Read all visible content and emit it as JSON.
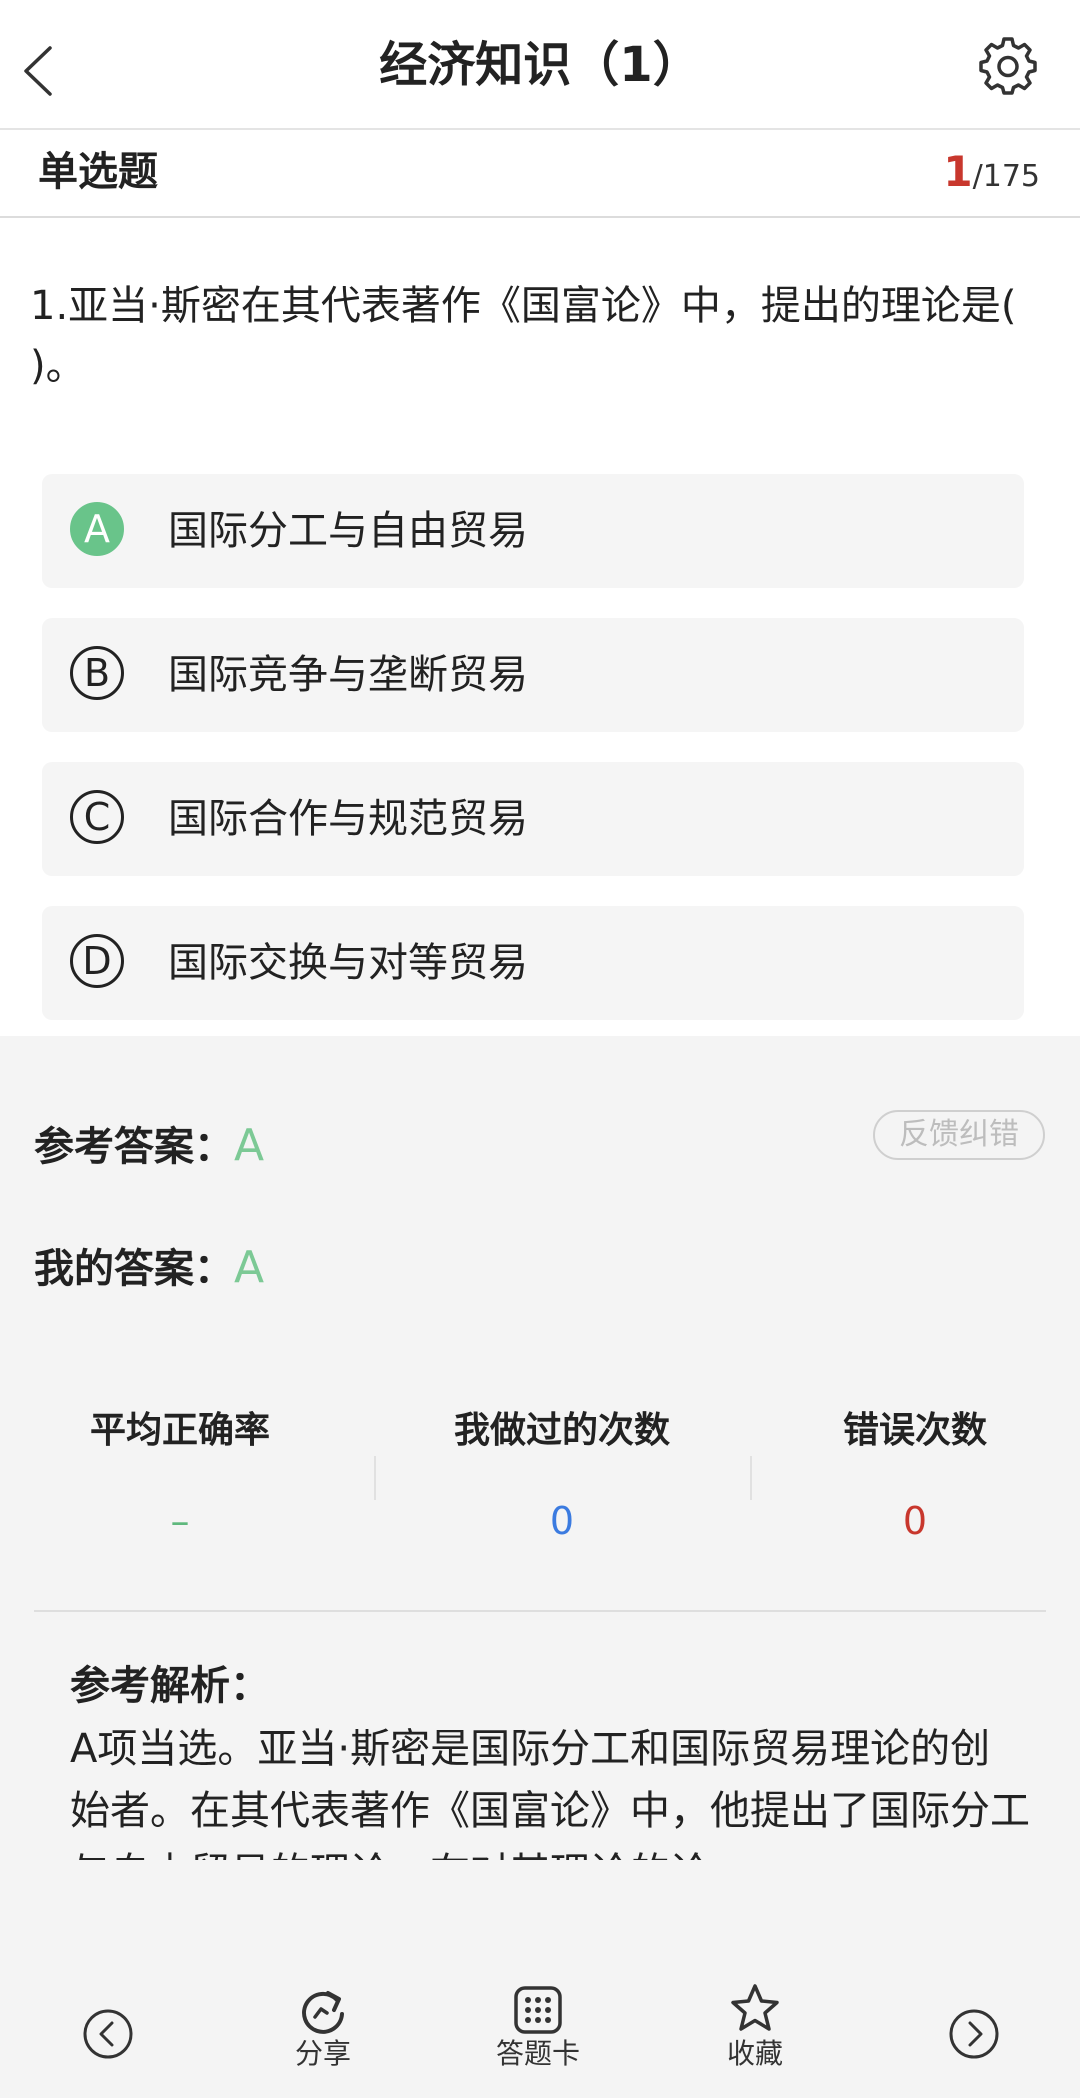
{
  "header": {
    "title": "经济知识（1）",
    "back_icon": "chevron-left-icon",
    "settings_icon": "gear-icon"
  },
  "subheader": {
    "question_type": "单选题",
    "current": "1",
    "total": "/175"
  },
  "question": {
    "text": "1.亚当·斯密在其代表著作《国富论》中，提出的理论是( )。"
  },
  "options": [
    {
      "letter": "A",
      "text": "国际分工与自由贸易",
      "selected": true
    },
    {
      "letter": "B",
      "text": "国际竞争与垄断贸易",
      "selected": false
    },
    {
      "letter": "C",
      "text": "国际合作与规范贸易",
      "selected": false
    },
    {
      "letter": "D",
      "text": "国际交换与对等贸易",
      "selected": false
    }
  ],
  "answer": {
    "reference_label": "参考答案：",
    "reference_value": "A",
    "mine_label": "我的答案：",
    "mine_value": "A",
    "feedback_button": "反馈纠错"
  },
  "stats": [
    {
      "label": "平均正确率",
      "value": "–",
      "color": "#5fb87d"
    },
    {
      "label": "我做过的次数",
      "value": "0",
      "color": "#3b7be0"
    },
    {
      "label": "错误次数",
      "value": "0",
      "color": "#c8372d"
    }
  ],
  "analysis": {
    "title": "参考解析：",
    "text": "A项当选。亚当·斯密是国际分工和国际贸易理论的创始者。在其代表著作《国富论》中，他提出了国际分工与自由贸易的理论，在对其理论的论"
  },
  "bottom_nav": {
    "prev_icon": "circle-chevron-left-icon",
    "share_label": "分享",
    "answer_card_label": "答题卡",
    "favorite_label": "收藏",
    "next_icon": "circle-chevron-right-icon"
  },
  "colors": {
    "accent_red": "#c8372d",
    "correct_green": "#69c48a",
    "answer_green": "#7cc995",
    "blue": "#3b7be0"
  }
}
